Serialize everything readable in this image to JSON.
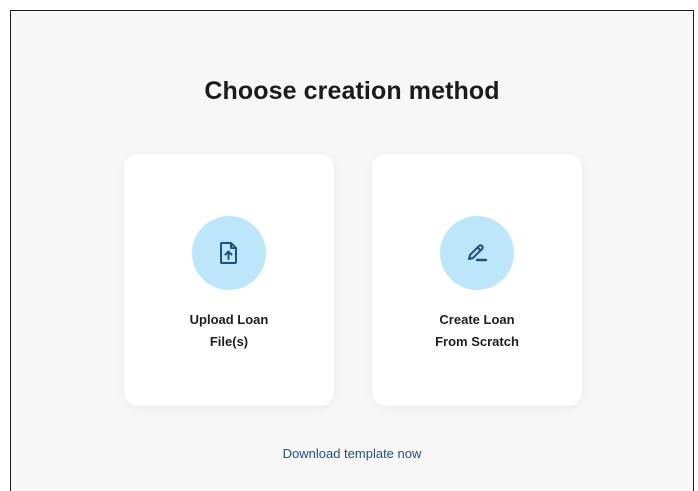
{
  "page": {
    "title": "Choose creation method"
  },
  "options": [
    {
      "line1": "Upload Loan",
      "line2": "File(s)",
      "icon": "file-upload-icon"
    },
    {
      "line1": "Create Loan",
      "line2": "From Scratch",
      "icon": "pen-edit-icon"
    }
  ],
  "footer": {
    "download_label": "Download template now"
  },
  "colors": {
    "background": "#f7f7f7",
    "card": "#ffffff",
    "icon_circle": "#bde6fb",
    "icon": "#1f4f86",
    "link": "#1f4f86",
    "title": "#1b1b1b"
  }
}
